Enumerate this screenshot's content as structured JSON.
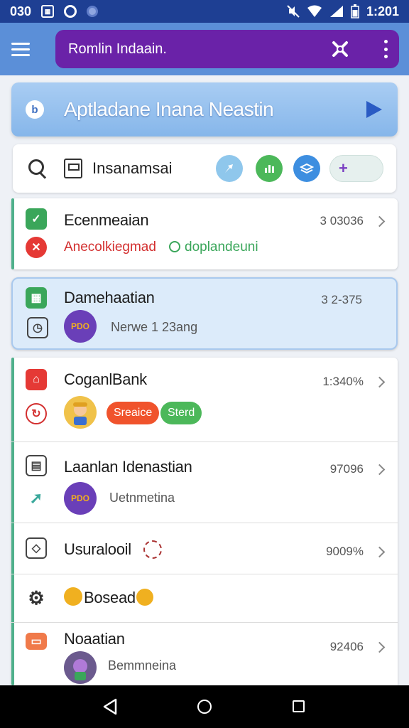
{
  "status_bar": {
    "time": "1:201",
    "left_label": "030"
  },
  "app_bar": {
    "title": "Romlin Indaain."
  },
  "banner": {
    "icon_letter": "b",
    "title": "Aptladane Inana Neastin"
  },
  "search": {
    "label": "Insanamsai",
    "chip_plus": "+"
  },
  "list": [
    {
      "title": "Ecenmeaian",
      "value": "3 03036",
      "subtitle": "Anecolkiegmad",
      "tag": "doplandeuni",
      "icon_color": "#3aa65a",
      "icon2_color": "#e53935"
    },
    {
      "title": "Damehaatian",
      "value": "3 2-375",
      "avatar_text": "PDO",
      "subtitle": "Nerwe 1 23ang",
      "selected": true
    },
    {
      "title": "CoganlBank",
      "value": "1:340%",
      "badge1": "Sreaice",
      "badge2": "Sterd"
    },
    {
      "title": "Laanlan Idenastian",
      "value": "97096",
      "avatar_text": "PDO",
      "subtitle": "Uetnmetina"
    },
    {
      "title": "Usuralooil",
      "value": "9009%"
    },
    {
      "title": "Bosead"
    },
    {
      "title": "Noaatian",
      "value": "92406",
      "subtitle": "Bemmneina"
    }
  ],
  "colors": {
    "status_bar": "#1e3f93",
    "app_bar": "#5b8fd8",
    "title_pill": "#6a22a8",
    "accent_green": "#4fb08b"
  }
}
